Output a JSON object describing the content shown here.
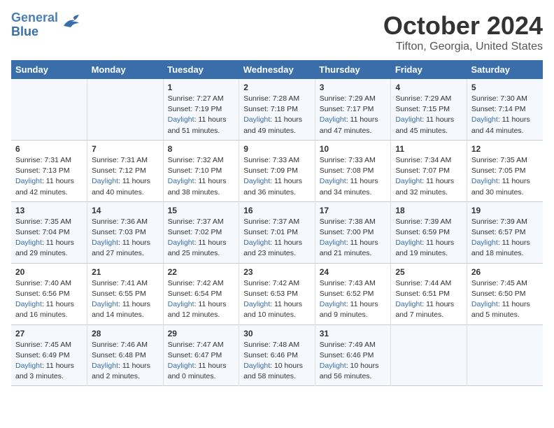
{
  "logo": {
    "line1": "General",
    "line2": "Blue"
  },
  "title": "October 2024",
  "location": "Tifton, Georgia, United States",
  "days_of_week": [
    "Sunday",
    "Monday",
    "Tuesday",
    "Wednesday",
    "Thursday",
    "Friday",
    "Saturday"
  ],
  "weeks": [
    [
      {
        "num": "",
        "sunrise": "",
        "sunset": "",
        "daylight": ""
      },
      {
        "num": "",
        "sunrise": "",
        "sunset": "",
        "daylight": ""
      },
      {
        "num": "1",
        "sunrise": "Sunrise: 7:27 AM",
        "sunset": "Sunset: 7:19 PM",
        "daylight": "Daylight: 11 hours and 51 minutes."
      },
      {
        "num": "2",
        "sunrise": "Sunrise: 7:28 AM",
        "sunset": "Sunset: 7:18 PM",
        "daylight": "Daylight: 11 hours and 49 minutes."
      },
      {
        "num": "3",
        "sunrise": "Sunrise: 7:29 AM",
        "sunset": "Sunset: 7:17 PM",
        "daylight": "Daylight: 11 hours and 47 minutes."
      },
      {
        "num": "4",
        "sunrise": "Sunrise: 7:29 AM",
        "sunset": "Sunset: 7:15 PM",
        "daylight": "Daylight: 11 hours and 45 minutes."
      },
      {
        "num": "5",
        "sunrise": "Sunrise: 7:30 AM",
        "sunset": "Sunset: 7:14 PM",
        "daylight": "Daylight: 11 hours and 44 minutes."
      }
    ],
    [
      {
        "num": "6",
        "sunrise": "Sunrise: 7:31 AM",
        "sunset": "Sunset: 7:13 PM",
        "daylight": "Daylight: 11 hours and 42 minutes."
      },
      {
        "num": "7",
        "sunrise": "Sunrise: 7:31 AM",
        "sunset": "Sunset: 7:12 PM",
        "daylight": "Daylight: 11 hours and 40 minutes."
      },
      {
        "num": "8",
        "sunrise": "Sunrise: 7:32 AM",
        "sunset": "Sunset: 7:10 PM",
        "daylight": "Daylight: 11 hours and 38 minutes."
      },
      {
        "num": "9",
        "sunrise": "Sunrise: 7:33 AM",
        "sunset": "Sunset: 7:09 PM",
        "daylight": "Daylight: 11 hours and 36 minutes."
      },
      {
        "num": "10",
        "sunrise": "Sunrise: 7:33 AM",
        "sunset": "Sunset: 7:08 PM",
        "daylight": "Daylight: 11 hours and 34 minutes."
      },
      {
        "num": "11",
        "sunrise": "Sunrise: 7:34 AM",
        "sunset": "Sunset: 7:07 PM",
        "daylight": "Daylight: 11 hours and 32 minutes."
      },
      {
        "num": "12",
        "sunrise": "Sunrise: 7:35 AM",
        "sunset": "Sunset: 7:05 PM",
        "daylight": "Daylight: 11 hours and 30 minutes."
      }
    ],
    [
      {
        "num": "13",
        "sunrise": "Sunrise: 7:35 AM",
        "sunset": "Sunset: 7:04 PM",
        "daylight": "Daylight: 11 hours and 29 minutes."
      },
      {
        "num": "14",
        "sunrise": "Sunrise: 7:36 AM",
        "sunset": "Sunset: 7:03 PM",
        "daylight": "Daylight: 11 hours and 27 minutes."
      },
      {
        "num": "15",
        "sunrise": "Sunrise: 7:37 AM",
        "sunset": "Sunset: 7:02 PM",
        "daylight": "Daylight: 11 hours and 25 minutes."
      },
      {
        "num": "16",
        "sunrise": "Sunrise: 7:37 AM",
        "sunset": "Sunset: 7:01 PM",
        "daylight": "Daylight: 11 hours and 23 minutes."
      },
      {
        "num": "17",
        "sunrise": "Sunrise: 7:38 AM",
        "sunset": "Sunset: 7:00 PM",
        "daylight": "Daylight: 11 hours and 21 minutes."
      },
      {
        "num": "18",
        "sunrise": "Sunrise: 7:39 AM",
        "sunset": "Sunset: 6:59 PM",
        "daylight": "Daylight: 11 hours and 19 minutes."
      },
      {
        "num": "19",
        "sunrise": "Sunrise: 7:39 AM",
        "sunset": "Sunset: 6:57 PM",
        "daylight": "Daylight: 11 hours and 18 minutes."
      }
    ],
    [
      {
        "num": "20",
        "sunrise": "Sunrise: 7:40 AM",
        "sunset": "Sunset: 6:56 PM",
        "daylight": "Daylight: 11 hours and 16 minutes."
      },
      {
        "num": "21",
        "sunrise": "Sunrise: 7:41 AM",
        "sunset": "Sunset: 6:55 PM",
        "daylight": "Daylight: 11 hours and 14 minutes."
      },
      {
        "num": "22",
        "sunrise": "Sunrise: 7:42 AM",
        "sunset": "Sunset: 6:54 PM",
        "daylight": "Daylight: 11 hours and 12 minutes."
      },
      {
        "num": "23",
        "sunrise": "Sunrise: 7:42 AM",
        "sunset": "Sunset: 6:53 PM",
        "daylight": "Daylight: 11 hours and 10 minutes."
      },
      {
        "num": "24",
        "sunrise": "Sunrise: 7:43 AM",
        "sunset": "Sunset: 6:52 PM",
        "daylight": "Daylight: 11 hours and 9 minutes."
      },
      {
        "num": "25",
        "sunrise": "Sunrise: 7:44 AM",
        "sunset": "Sunset: 6:51 PM",
        "daylight": "Daylight: 11 hours and 7 minutes."
      },
      {
        "num": "26",
        "sunrise": "Sunrise: 7:45 AM",
        "sunset": "Sunset: 6:50 PM",
        "daylight": "Daylight: 11 hours and 5 minutes."
      }
    ],
    [
      {
        "num": "27",
        "sunrise": "Sunrise: 7:45 AM",
        "sunset": "Sunset: 6:49 PM",
        "daylight": "Daylight: 11 hours and 3 minutes."
      },
      {
        "num": "28",
        "sunrise": "Sunrise: 7:46 AM",
        "sunset": "Sunset: 6:48 PM",
        "daylight": "Daylight: 11 hours and 2 minutes."
      },
      {
        "num": "29",
        "sunrise": "Sunrise: 7:47 AM",
        "sunset": "Sunset: 6:47 PM",
        "daylight": "Daylight: 11 hours and 0 minutes."
      },
      {
        "num": "30",
        "sunrise": "Sunrise: 7:48 AM",
        "sunset": "Sunset: 6:46 PM",
        "daylight": "Daylight: 10 hours and 58 minutes."
      },
      {
        "num": "31",
        "sunrise": "Sunrise: 7:49 AM",
        "sunset": "Sunset: 6:46 PM",
        "daylight": "Daylight: 10 hours and 56 minutes."
      },
      {
        "num": "",
        "sunrise": "",
        "sunset": "",
        "daylight": ""
      },
      {
        "num": "",
        "sunrise": "",
        "sunset": "",
        "daylight": ""
      }
    ]
  ]
}
